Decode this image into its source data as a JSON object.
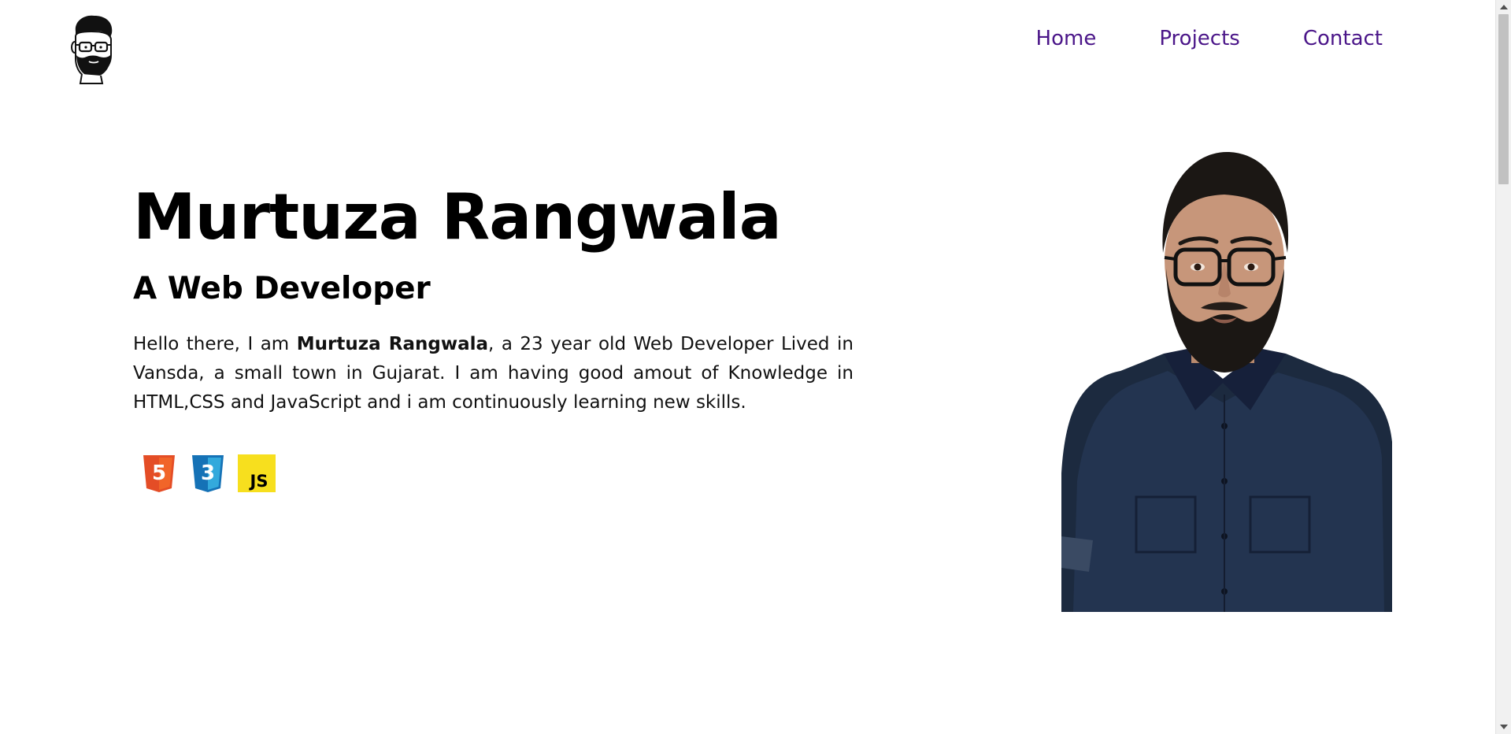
{
  "header": {
    "logo_icon": "bearded-man-avatar-icon",
    "nav": [
      {
        "label": "Home"
      },
      {
        "label": "Projects"
      },
      {
        "label": "Contact"
      }
    ],
    "nav_color": "#4b1689"
  },
  "hero": {
    "name": "Murtuza Rangwala",
    "role": "A Web Developer",
    "bio_prefix": "Hello there, I am ",
    "bio_name": "Murtuza Rangwala",
    "bio_suffix": ", a 23 year old Web Developer Lived in Vansda, a small town in Gujarat. I am having good amout of Knowledge in HTML,CSS and JavaScript and i am continuously learning new skills.",
    "skills": [
      {
        "icon": "html5-icon",
        "label": "5",
        "color": "#e44d26"
      },
      {
        "icon": "css3-icon",
        "label": "3",
        "color": "#1572b6"
      },
      {
        "icon": "javascript-icon",
        "label": "JS",
        "color": "#f7df1e"
      }
    ]
  },
  "portrait": {
    "icon": "portrait-photo"
  }
}
